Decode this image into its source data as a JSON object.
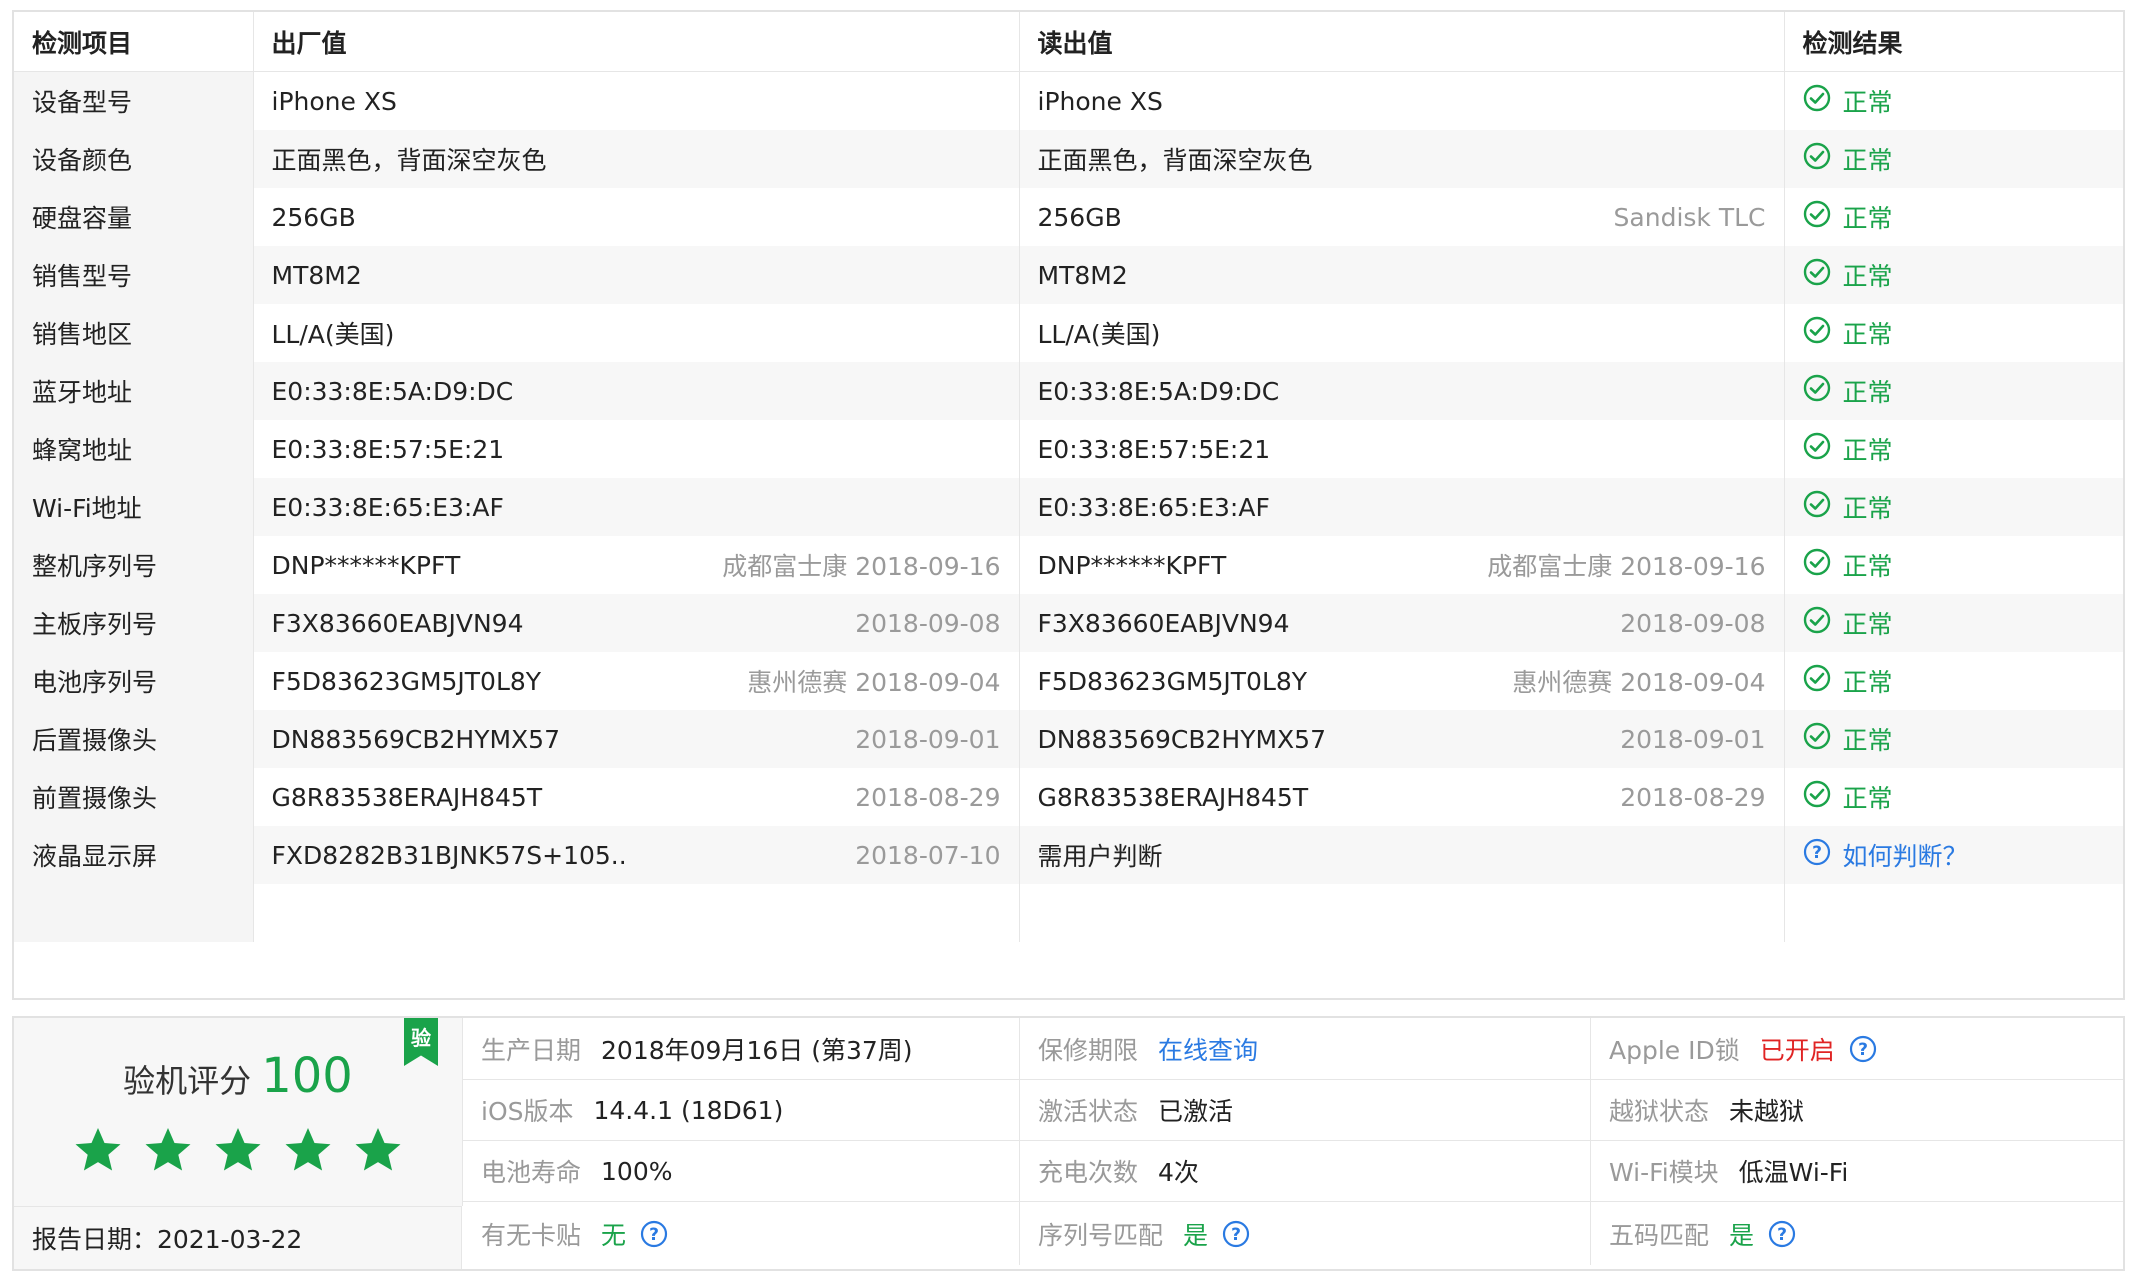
{
  "table": {
    "headers": [
      "检测项目",
      "出厂值",
      "读出值",
      "检测结果"
    ],
    "rows": [
      {
        "item": "设备型号",
        "factory": "iPhone XS",
        "factory_note": "",
        "read": "iPhone XS",
        "read_note": "",
        "result": "正常"
      },
      {
        "item": "设备颜色",
        "factory": "正面黑色，背面深空灰色",
        "factory_note": "",
        "read": "正面黑色，背面深空灰色",
        "read_note": "",
        "result": "正常"
      },
      {
        "item": "硬盘容量",
        "factory": "256GB",
        "factory_note": "",
        "read": "256GB",
        "read_note": "Sandisk TLC",
        "result": "正常"
      },
      {
        "item": "销售型号",
        "factory": "MT8M2",
        "factory_note": "",
        "read": "MT8M2",
        "read_note": "",
        "result": "正常"
      },
      {
        "item": "销售地区",
        "factory": "LL/A(美国)",
        "factory_note": "",
        "read": "LL/A(美国)",
        "read_note": "",
        "result": "正常"
      },
      {
        "item": "蓝牙地址",
        "factory": "E0:33:8E:5A:D9:DC",
        "factory_note": "",
        "read": "E0:33:8E:5A:D9:DC",
        "read_note": "",
        "result": "正常"
      },
      {
        "item": "蜂窝地址",
        "factory": "E0:33:8E:57:5E:21",
        "factory_note": "",
        "read": "E0:33:8E:57:5E:21",
        "read_note": "",
        "result": "正常"
      },
      {
        "item": "Wi-Fi地址",
        "factory": "E0:33:8E:65:E3:AF",
        "factory_note": "",
        "read": "E0:33:8E:65:E3:AF",
        "read_note": "",
        "result": "正常"
      },
      {
        "item": "整机序列号",
        "factory": "DNP******KPFT",
        "factory_note": "成都富士康 2018-09-16",
        "read": "DNP******KPFT",
        "read_note": "成都富士康 2018-09-16",
        "result": "正常"
      },
      {
        "item": "主板序列号",
        "factory": "F3X83660EABJVN94",
        "factory_note": "2018-09-08",
        "read": "F3X83660EABJVN94",
        "read_note": "2018-09-08",
        "result": "正常"
      },
      {
        "item": "电池序列号",
        "factory": "F5D83623GM5JT0L8Y",
        "factory_note": "惠州德赛 2018-09-04",
        "read": "F5D83623GM5JT0L8Y",
        "read_note": "惠州德赛 2018-09-04",
        "result": "正常"
      },
      {
        "item": "后置摄像头",
        "factory": "DN883569CB2HYMX57",
        "factory_note": "2018-09-01",
        "read": "DN883569CB2HYMX57",
        "read_note": "2018-09-01",
        "result": "正常"
      },
      {
        "item": "前置摄像头",
        "factory": "G8R83538ERAJH845T",
        "factory_note": "2018-08-29",
        "read": "G8R83538ERAJH845T",
        "read_note": "2018-08-29",
        "result": "正常"
      },
      {
        "item": "液晶显示屏",
        "factory": "FXD8282B31BJNK57S+105..",
        "factory_note": "2018-07-10",
        "read": "需用户判断",
        "read_note": "",
        "result": "如何判断？"
      }
    ]
  },
  "summary": {
    "score_label": "验机评分",
    "score": "100",
    "stars": 5,
    "badge": "验",
    "report_date": "报告日期：2021-03-22",
    "cells": [
      {
        "label": "生产日期",
        "value": "2018年09月16日 (第37周)",
        "style": "plain",
        "help": false
      },
      {
        "label": "保修期限",
        "value": "在线查询",
        "style": "link",
        "help": false
      },
      {
        "label": "Apple ID锁",
        "value": "已开启",
        "style": "red",
        "help": true
      },
      {
        "label": "iOS版本",
        "value": "14.4.1 (18D61)",
        "style": "plain",
        "help": false
      },
      {
        "label": "激活状态",
        "value": "已激活",
        "style": "plain",
        "help": false
      },
      {
        "label": "越狱状态",
        "value": "未越狱",
        "style": "plain",
        "help": false
      },
      {
        "label": "电池寿命",
        "value": "100%",
        "style": "plain",
        "help": false
      },
      {
        "label": "充电次数",
        "value": "4次",
        "style": "plain",
        "help": false
      },
      {
        "label": "Wi-Fi模块",
        "value": "低温Wi-Fi",
        "style": "plain",
        "help": false
      },
      {
        "label": "有无卡贴",
        "value": "无",
        "style": "green",
        "help": true
      },
      {
        "label": "序列号匹配",
        "value": "是",
        "style": "green",
        "help": true
      },
      {
        "label": "五码匹配",
        "value": "是",
        "style": "green",
        "help": true
      }
    ]
  },
  "colors": {
    "ok_green": "#1aa34a",
    "link_blue": "#2a7ae2",
    "alert_red": "#e02424",
    "muted": "#9a9a9a"
  }
}
